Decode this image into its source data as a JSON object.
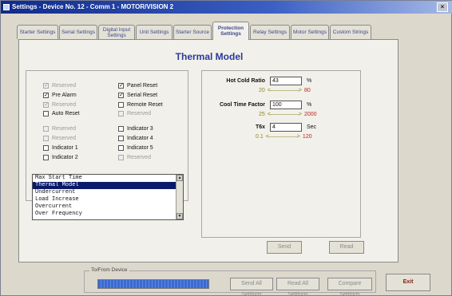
{
  "window": {
    "title": "Settings - Device No. 12 - Comm 1 - MOTOR/VISION 2",
    "close_icon": "×"
  },
  "tabs": [
    {
      "label": "Starter Settings"
    },
    {
      "label": "Serial Settings"
    },
    {
      "label": "Digital Input Settings"
    },
    {
      "label": "Unit Settings"
    },
    {
      "label": "Starter Source"
    },
    {
      "label": "Protection Settings",
      "active": true
    },
    {
      "label": "Relay Settings"
    },
    {
      "label": "Motor Settings"
    },
    {
      "label": "Custom Strings"
    }
  ],
  "panel": {
    "title": "Thermal Model"
  },
  "checkboxes_left": [
    {
      "label": "Reserved",
      "checked": true,
      "enabled": false
    },
    {
      "label": "Pre Alarm",
      "checked": true,
      "enabled": true
    },
    {
      "label": "Reserved",
      "checked": true,
      "enabled": false
    },
    {
      "label": "Auto Reset",
      "checked": false,
      "enabled": true
    },
    {
      "label": "Reserved",
      "checked": false,
      "enabled": false
    },
    {
      "label": "Reserved",
      "checked": false,
      "enabled": false
    },
    {
      "label": "Indicator 1",
      "checked": false,
      "enabled": true
    },
    {
      "label": "Indicator 2",
      "checked": false,
      "enabled": true
    }
  ],
  "checkboxes_right": [
    {
      "label": "Panel Reset",
      "checked": true,
      "enabled": true
    },
    {
      "label": "Serial Reset",
      "checked": true,
      "enabled": true
    },
    {
      "label": "Remote Reset",
      "checked": false,
      "enabled": true
    },
    {
      "label": "Reserved",
      "checked": false,
      "enabled": false
    },
    {
      "label": "Indicator 3",
      "checked": false,
      "enabled": true
    },
    {
      "label": "Indicator 4",
      "checked": false,
      "enabled": true
    },
    {
      "label": "Indicator 5",
      "checked": false,
      "enabled": true
    },
    {
      "label": "Reserved",
      "checked": false,
      "enabled": false
    }
  ],
  "protection_list": {
    "items": [
      {
        "label": "Max Start Time"
      },
      {
        "label": "Thermal Model",
        "selected": true
      },
      {
        "label": "Undercurrent"
      },
      {
        "label": "Load Increase"
      },
      {
        "label": "Overcurrent"
      },
      {
        "label": "Over Frequency"
      }
    ]
  },
  "params": [
    {
      "label": "Hot Cold Ratio",
      "value": "43",
      "unit": "%",
      "min": "20",
      "max": "80"
    },
    {
      "label": "Cool Time Factor",
      "value": "100",
      "unit": "%",
      "min": "25",
      "max": "2000"
    },
    {
      "label": "T6x",
      "value": "4",
      "unit": "Sec",
      "min": "0.1",
      "max": "120"
    }
  ],
  "buttons": {
    "send": "Send",
    "read": "Read",
    "send_all": "Send All Settings",
    "read_all": "Read All Settings",
    "compare": "Compare Settings",
    "exit": "Exit"
  },
  "transfer": {
    "label": "To/From Device",
    "progress": 1.0
  },
  "colors": {
    "title_accent": "#2a3a9a",
    "min_color": "#8a8a20",
    "max_color": "#c02020",
    "progress": "#3a6ad0"
  }
}
